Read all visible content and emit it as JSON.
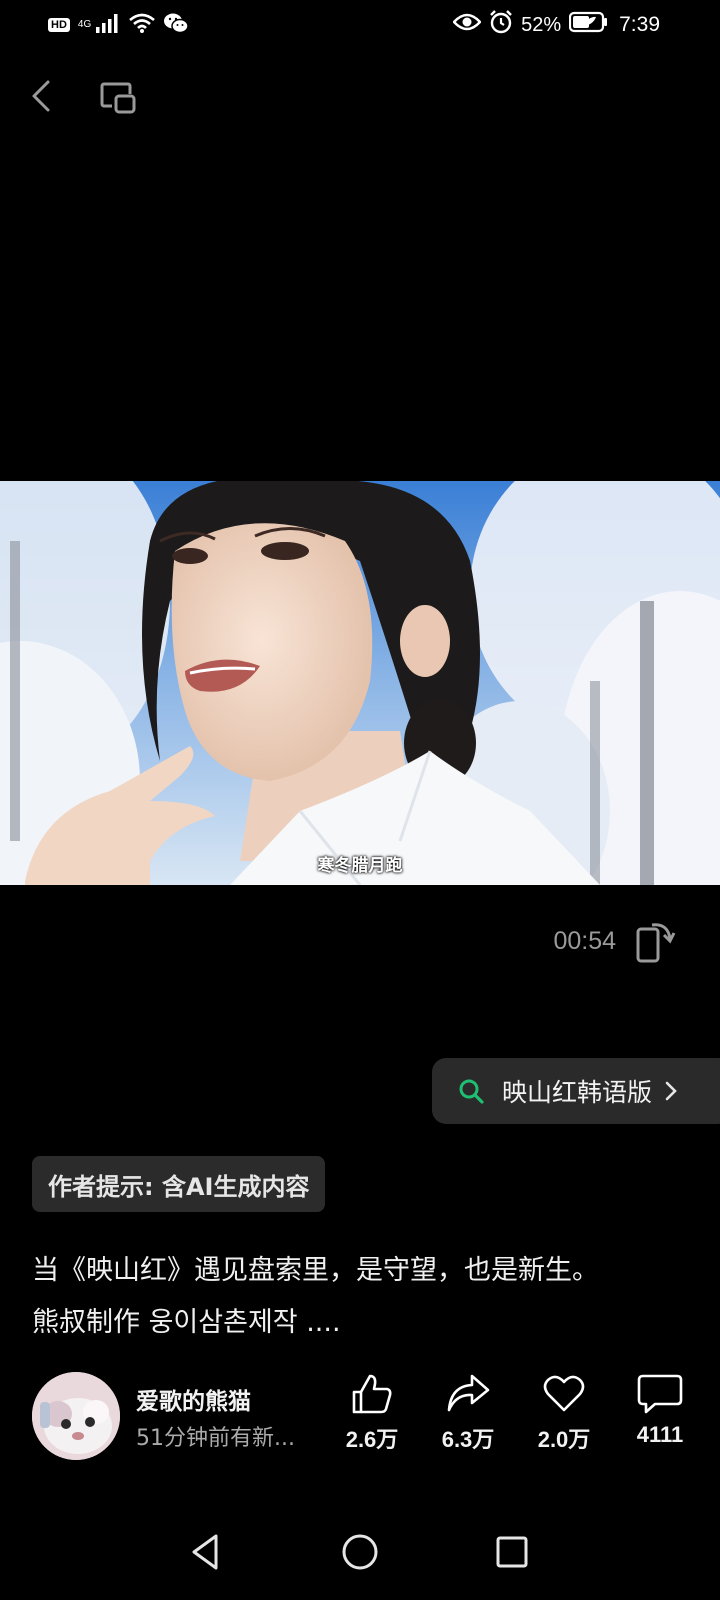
{
  "status_bar": {
    "hd": "HD",
    "network": "4G",
    "battery": "52%",
    "time": "7:39",
    "icons": [
      "signal-icon",
      "wifi-icon",
      "wechat-icon",
      "eye-icon",
      "alarm-icon",
      "battery-icon"
    ]
  },
  "top_bar": {
    "icons": [
      "back-icon",
      "window-mode-icon"
    ]
  },
  "video": {
    "subtitle": "寒冬腊月跑",
    "timestamp": "00:54"
  },
  "search_chip": {
    "label": "映山红韩语版"
  },
  "ai_notice": "作者提示: 含AI生成内容",
  "description": {
    "line1": "当《映山红》遇见盘索里，是守望，也是新生。",
    "line2": "熊叔制作 웅이삼촌제작 ...."
  },
  "author": {
    "name": "爱歌的熊猫",
    "subtitle": "51分钟前有新..."
  },
  "actions": {
    "like": "2.6万",
    "share": "6.3万",
    "favorite": "2.0万",
    "comment": "4111"
  },
  "colors": {
    "background": "#000000",
    "chip_bg": "#2a2a2a",
    "search_icon": "#1fbf72",
    "muted_text": "#9a9a9a"
  }
}
